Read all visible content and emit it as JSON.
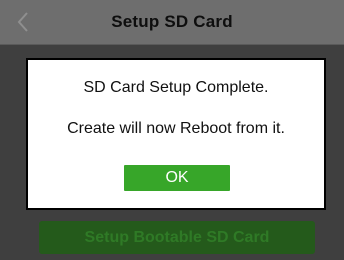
{
  "header": {
    "title": "Setup SD Card",
    "back_glyph": "<"
  },
  "main": {
    "bootable_button_label": "Setup Bootable SD Card"
  },
  "dialog": {
    "message_1": "SD Card Setup Complete.",
    "message_2": "Create will now Reboot from it.",
    "ok_label": "OK"
  },
  "colors": {
    "ok_button": "#37a629",
    "bootable_button_dimmed": "#245a1b"
  }
}
